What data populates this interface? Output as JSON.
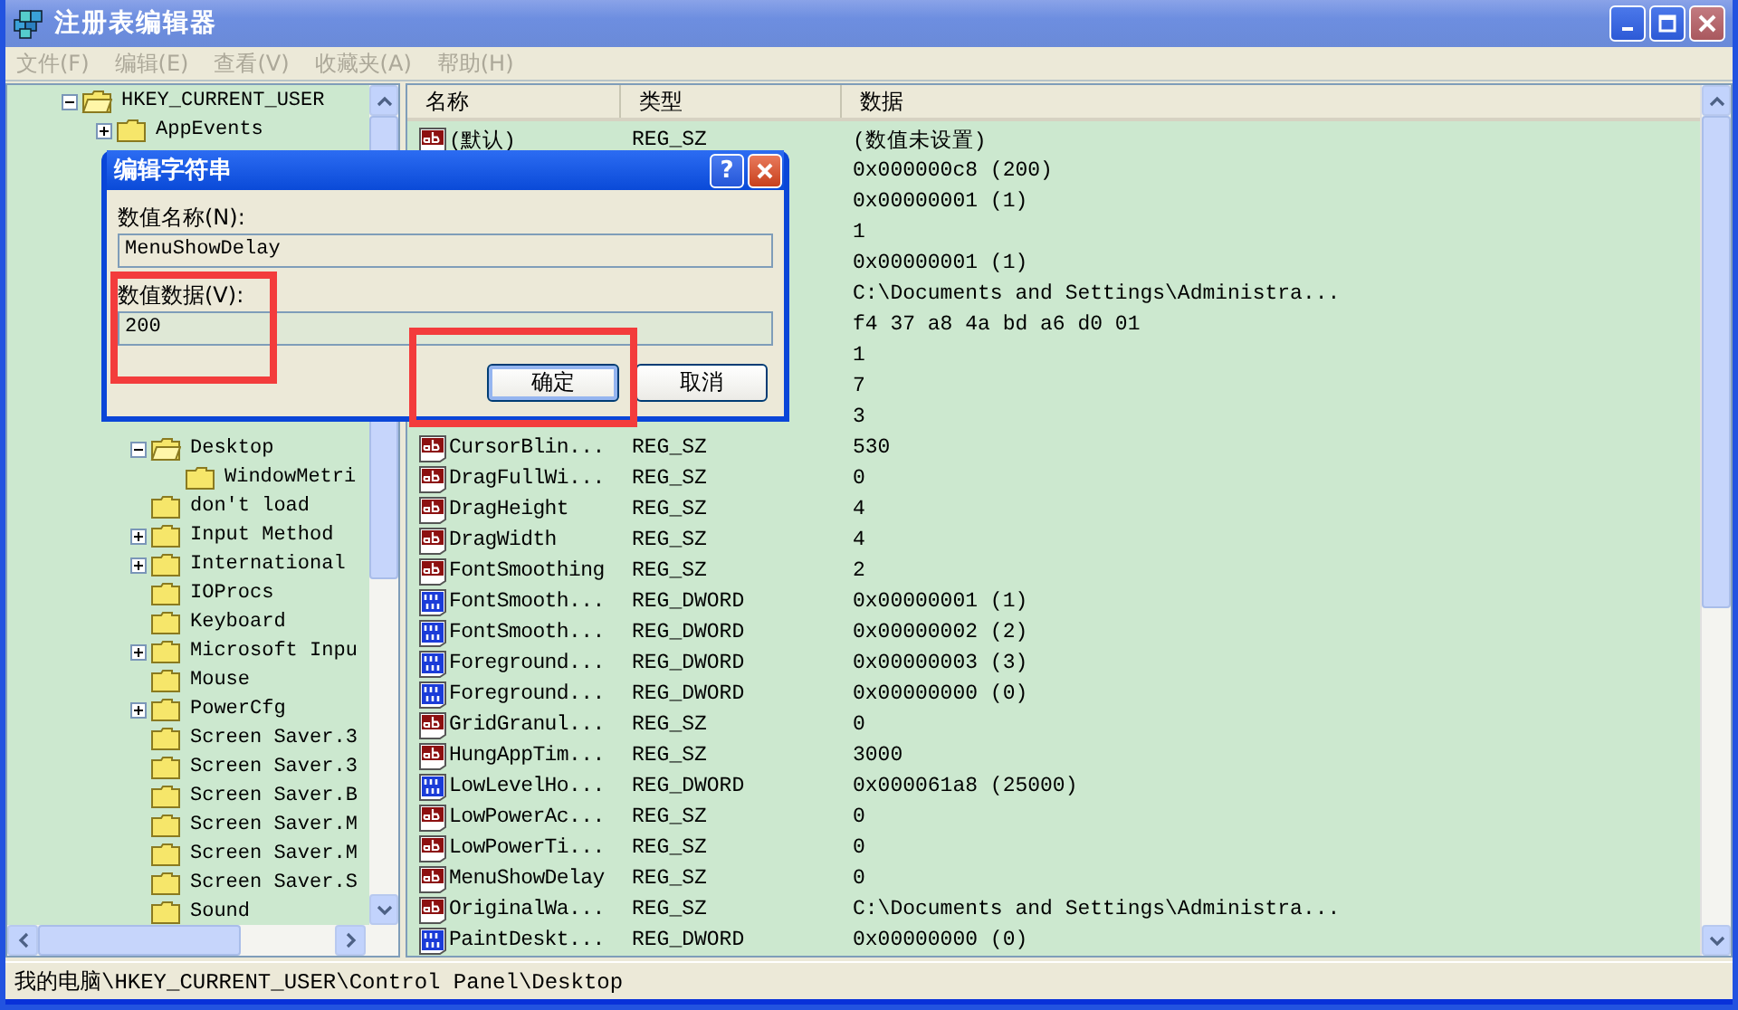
{
  "window": {
    "title": "注册表编辑器"
  },
  "menu": [
    {
      "label": "文件(F)",
      "disabled": true
    },
    {
      "label": "编辑(E)",
      "disabled": true
    },
    {
      "label": "查看(V)",
      "disabled": true
    },
    {
      "label": "收藏夹(A)",
      "disabled": true
    },
    {
      "label": "帮助(H)",
      "disabled": true
    }
  ],
  "tree": [
    {
      "label": "HKEY_CURRENT_USER",
      "expanded": true,
      "children": [
        {
          "label": "AppEvents",
          "expanded": false
        },
        {
          "children": [
            {
              "label": "Desktop",
              "expanded": true,
              "children": [
                {
                  "label": "WindowMetri"
                }
              ]
            },
            {
              "label": "don't load"
            },
            {
              "label": "Input Method",
              "expanded": false
            },
            {
              "label": "International",
              "expanded": false
            },
            {
              "label": "IOProcs"
            },
            {
              "label": "Keyboard"
            },
            {
              "label": "Microsoft Inpu",
              "expanded": false
            },
            {
              "label": "Mouse"
            },
            {
              "label": "PowerCfg",
              "expanded": false
            },
            {
              "label": "Screen Saver.3"
            },
            {
              "label": "Screen Saver.3"
            },
            {
              "label": "Screen Saver.B"
            },
            {
              "label": "Screen Saver.M"
            },
            {
              "label": "Screen Saver.M"
            },
            {
              "label": "Screen Saver.S"
            },
            {
              "label": "Sound"
            }
          ]
        }
      ]
    }
  ],
  "list": {
    "columns": [
      "名称",
      "类型",
      "数据"
    ],
    "rows": [
      {
        "kind": "string",
        "name": "(默认)",
        "type": "REG_SZ",
        "data": "(数值未设置)"
      },
      {
        "data": "0x000000c8 (200)"
      },
      {
        "data": "0x00000001 (1)"
      },
      {
        "data": "1"
      },
      {
        "data": "0x00000001 (1)"
      },
      {
        "data": "C:\\Documents and Settings\\Administra..."
      },
      {
        "data": "f4 37 a8 4a bd a6 d0 01"
      },
      {
        "data": "1"
      },
      {
        "data": "7"
      },
      {
        "data": "3"
      },
      {
        "kind": "string",
        "name": "CursorBlin...",
        "type": "REG_SZ",
        "data": "530"
      },
      {
        "kind": "string",
        "name": "DragFullWi...",
        "type": "REG_SZ",
        "data": "0"
      },
      {
        "kind": "string",
        "name": "DragHeight",
        "type": "REG_SZ",
        "data": "4"
      },
      {
        "kind": "string",
        "name": "DragWidth",
        "type": "REG_SZ",
        "data": "4"
      },
      {
        "kind": "string",
        "name": "FontSmoothing",
        "type": "REG_SZ",
        "data": "2"
      },
      {
        "kind": "dword",
        "name": "FontSmooth...",
        "type": "REG_DWORD",
        "data": "0x00000001 (1)"
      },
      {
        "kind": "dword",
        "name": "FontSmooth...",
        "type": "REG_DWORD",
        "data": "0x00000002 (2)"
      },
      {
        "kind": "dword",
        "name": "Foreground...",
        "type": "REG_DWORD",
        "data": "0x00000003 (3)"
      },
      {
        "kind": "dword",
        "name": "Foreground...",
        "type": "REG_DWORD",
        "data": "0x00000000 (0)"
      },
      {
        "kind": "string",
        "name": "GridGranul...",
        "type": "REG_SZ",
        "data": "0"
      },
      {
        "kind": "string",
        "name": "HungAppTim...",
        "type": "REG_SZ",
        "data": "3000"
      },
      {
        "kind": "dword",
        "name": "LowLevelHo...",
        "type": "REG_DWORD",
        "data": "0x000061a8 (25000)"
      },
      {
        "kind": "string",
        "name": "LowPowerAc...",
        "type": "REG_SZ",
        "data": "0"
      },
      {
        "kind": "string",
        "name": "LowPowerTi...",
        "type": "REG_SZ",
        "data": "0"
      },
      {
        "kind": "string",
        "name": "MenuShowDelay",
        "type": "REG_SZ",
        "data": "0"
      },
      {
        "kind": "string",
        "name": "OriginalWa...",
        "type": "REG_SZ",
        "data": "C:\\Documents and Settings\\Administra..."
      },
      {
        "kind": "dword",
        "name": "PaintDeskt...",
        "type": "REG_DWORD",
        "data": "0x00000000 (0)"
      }
    ]
  },
  "dialog": {
    "title": "编辑字符串",
    "help_button": "?",
    "name_label": "数值名称(N):",
    "name_value": "MenuShowDelay",
    "data_label": "数值数据(V):",
    "data_value": "200",
    "data_highlighted": true,
    "buttons": [
      {
        "label": "确定",
        "default": true,
        "highlighted": true
      },
      {
        "label": "取消",
        "default": false,
        "highlighted": false
      }
    ]
  },
  "status_bar": "我的电脑\\HKEY_CURRENT_USER\\Control Panel\\Desktop"
}
